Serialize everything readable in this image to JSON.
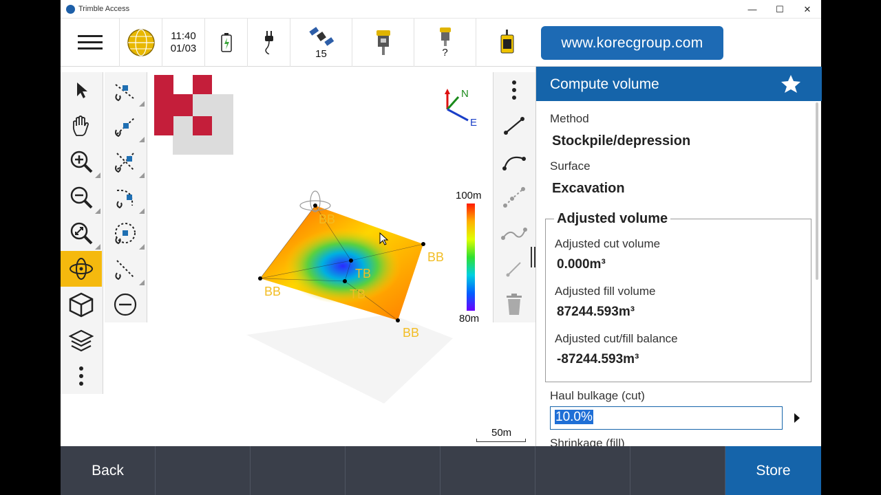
{
  "window": {
    "title": "Trimble Access",
    "minimize": "—",
    "maximize": "☐",
    "close": "✕"
  },
  "statusbar": {
    "time": "11:40",
    "date": "01/03",
    "satellites": "15",
    "receiver2": "?"
  },
  "weblink": "www.korecgroup.com",
  "map": {
    "scale_top": "100m",
    "scale_bottom": "80m",
    "north": "N",
    "east": "E",
    "scale_bar": "50m",
    "point_labels": [
      "BB",
      "BB",
      "BB",
      "BB",
      "TB",
      "TB"
    ]
  },
  "panel": {
    "title": "Compute volume",
    "method_label": "Method",
    "method_value": "Stockpile/depression",
    "surface_label": "Surface",
    "surface_value": "Excavation",
    "adjusted_title": "Adjusted volume",
    "cut_label": "Adjusted cut volume",
    "cut_value": "0.000m³",
    "fill_label": "Adjusted fill volume",
    "fill_value": "87244.593m³",
    "balance_label": "Adjusted cut/fill balance",
    "balance_value": "-87244.593m³",
    "haul_label": "Haul bulkage (cut)",
    "haul_value": "10.0%",
    "shrink_label": "Shrinkage (fill)"
  },
  "bottombar": {
    "back": "Back",
    "store": "Store"
  },
  "colors": {
    "accent": "#1564aa",
    "bottom": "#3a3f4a",
    "active_tool": "#f5b90e",
    "labels": "#f2bd24"
  }
}
